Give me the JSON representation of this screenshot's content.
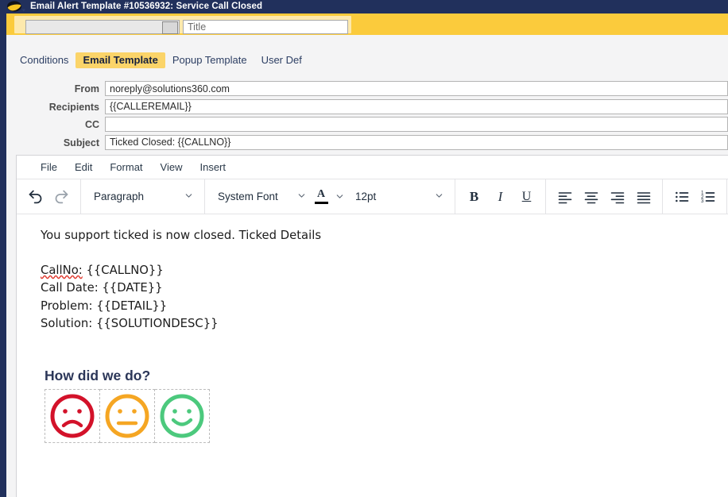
{
  "window": {
    "title": "Email Alert Template #10536932: Service Call Closed",
    "logo_icon": "solutions360-sphere-logo"
  },
  "banner": {
    "dropdown": {
      "value": "",
      "icon": "dropdown-button-icon"
    },
    "title_field": {
      "value": "",
      "placeholder": "Title"
    }
  },
  "tabs": [
    {
      "label": "Conditions",
      "active": false
    },
    {
      "label": "Email Template",
      "active": true
    },
    {
      "label": "Popup Template",
      "active": false
    },
    {
      "label": "User Def",
      "active": false
    }
  ],
  "fields": [
    {
      "label": "From",
      "value": "noreply@solutions360.com"
    },
    {
      "label": "Recipients",
      "value": "{{CALLEREMAIL}}"
    },
    {
      "label": "CC",
      "value": ""
    },
    {
      "label": "Subject",
      "value": "Ticked Closed: {{CALLNO}}"
    }
  ],
  "editor": {
    "menu": [
      "File",
      "Edit",
      "Format",
      "View",
      "Insert"
    ],
    "toolbar": {
      "undo": {
        "icon": "undo-icon",
        "label": "Undo",
        "enabled": true
      },
      "redo": {
        "icon": "redo-icon",
        "label": "Redo",
        "enabled": false
      },
      "block_format": "Paragraph",
      "font_family": "System Font",
      "font_size": "12pt",
      "text_color": {
        "icon": "text-color-icon",
        "color": "#000000"
      },
      "bold": "B",
      "italic": "I",
      "underline": "U",
      "align_left": "align-left-icon",
      "align_center": "align-center-icon",
      "align_right": "align-right-icon",
      "align_justify": "align-justify-icon",
      "bullet_list": "bullet-list-icon",
      "numbered_list": "numbered-list-icon",
      "link": "link-icon"
    },
    "body": {
      "intro": "You support ticked is now closed.  Ticked Details",
      "lines": [
        {
          "label": "CallNo:",
          "value": " {{CALLNO}}",
          "misspelled": true
        },
        {
          "label": "Call Date:",
          "value": " {{DATE}}",
          "misspelled": false
        },
        {
          "label": "Problem:",
          "value": " {{DETAIL}}",
          "misspelled": false
        },
        {
          "label": "Solution:",
          "value": " {{SOLUTIONDESC}}",
          "misspelled": false
        }
      ],
      "survey_heading": "How did we do?",
      "survey_faces": [
        {
          "name": "sad-face-icon",
          "color": "#d3122a",
          "mood": "sad"
        },
        {
          "name": "neutral-face-icon",
          "color": "#f5a623",
          "mood": "neutral"
        },
        {
          "name": "happy-face-icon",
          "color": "#4cc97d",
          "mood": "happy"
        }
      ]
    }
  },
  "colors": {
    "navy": "#21305c",
    "banner_yellow": "#fbcb3c",
    "tab_active": "#fbd469"
  }
}
